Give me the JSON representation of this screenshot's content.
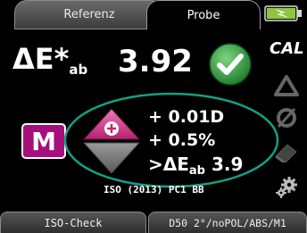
{
  "tabs": [
    {
      "label": "Referenz",
      "active": false
    },
    {
      "label": "Probe",
      "active": true
    }
  ],
  "measurement": {
    "symbol": "ΔE*",
    "symbol_sub": "ab",
    "value": "3.92",
    "status": "ok"
  },
  "mode_button": {
    "label": "M"
  },
  "corrections": {
    "line1": "+ 0.01D",
    "line2": "+ 0.5%",
    "line3_prefix": ">ΔE",
    "line3_sub": "ab",
    "line3_value": " 3.9"
  },
  "standard_label": "ISO (2013) PC1 BB",
  "side_icons": {
    "cal_label": "CAL",
    "icons": [
      "battery-icon",
      "calibration-icon",
      "triangle-icon",
      "density-icon",
      "eraser-icon",
      "settings-gear-icon"
    ]
  },
  "bottom_bar": {
    "left_label": "ISO-Check",
    "right_label": "D50 2°/noPOL/ABS/M1"
  },
  "colors": {
    "accent_magenta": "#a50f7b",
    "ok_green": "#2e9e3a",
    "ellipse_teal": "#13a085"
  }
}
